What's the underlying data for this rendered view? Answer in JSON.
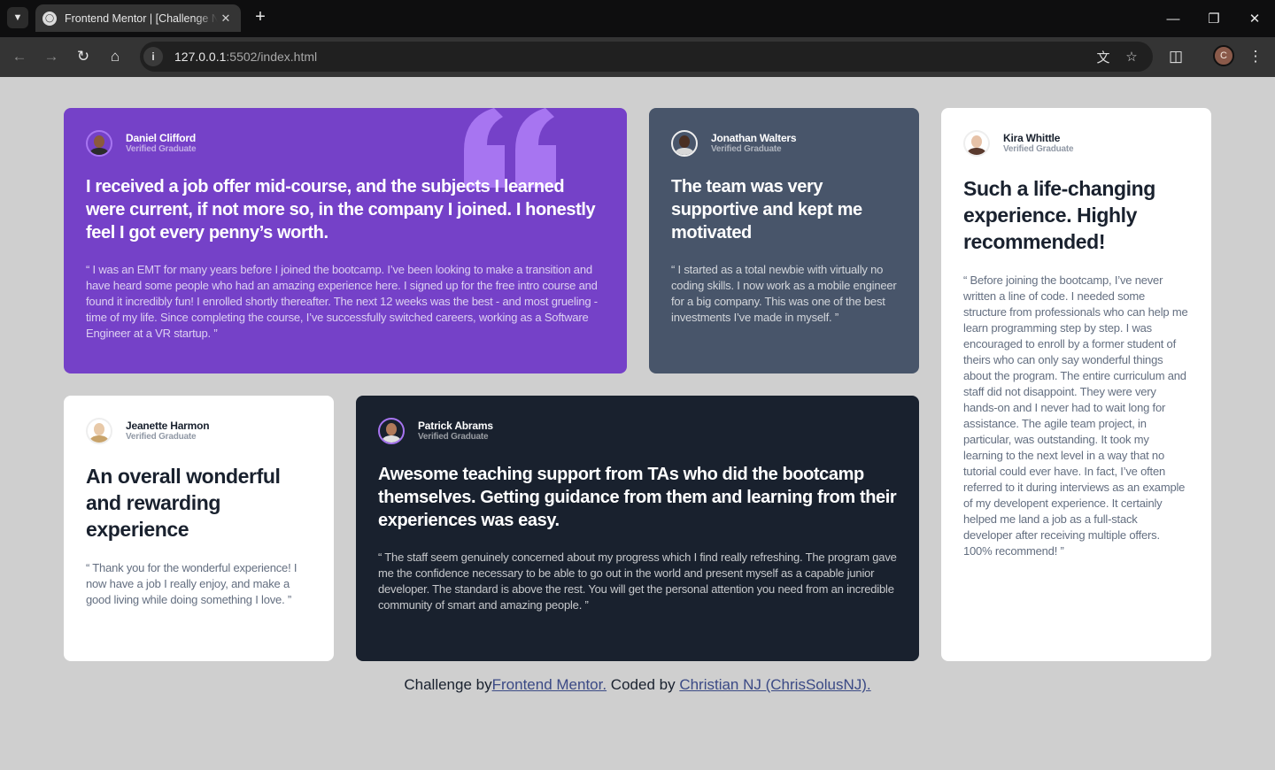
{
  "browser": {
    "tab_title": "Frontend Mentor | [Challenge N",
    "url_host": "127.0.0.1",
    "url_rest": ":5502/index.html",
    "profile_initial": "C"
  },
  "testimonials": [
    {
      "name": "Daniel Clifford",
      "role": "Verified Graduate",
      "headline": "I received a job offer mid-course, and the subjects I learned were current, if not more so, in the company I joined. I honestly feel I got every penny’s worth.",
      "body": "“ I was an EMT for many years before I joined the bootcamp. I’ve been looking to make a transition and have heard some people who had an amazing experience here. I signed up for the free intro course and found it incredibly fun! I enrolled shortly thereafter. The next 12 weeks was the best - and most grueling - time of my life. Since completing the course, I’ve successfully switched careers, working as a Software Engineer at a VR startup. ”"
    },
    {
      "name": "Jonathan Walters",
      "role": "Verified Graduate",
      "headline": "The team was very supportive and kept me motivated",
      "body": "“ I started as a total newbie with virtually no coding skills. I now work as a mobile engineer for a big company. This was one of the best investments I’ve made in myself. ”"
    },
    {
      "name": "Kira Whittle",
      "role": "Verified Graduate",
      "headline": "Such a life-changing experience. Highly recommended!",
      "body": "“ Before joining the bootcamp, I’ve never written a line of code. I needed some structure from professionals who can help me learn programming step by step. I was encouraged to enroll by a former student of theirs who can only say wonderful things about the program. The entire curriculum and staff did not disappoint. They were very hands-on and I never had to wait long for assistance. The agile team project, in particular, was outstanding. It took my learning to the next level in a way that no tutorial could ever have. In fact, I’ve often referred to it during interviews as an example of my developent experience. It certainly helped me land a job as a full-stack developer after receiving multiple offers. 100% recommend! ”"
    },
    {
      "name": "Jeanette Harmon",
      "role": "Verified Graduate",
      "headline": "An overall wonderful and rewarding experience",
      "body": "“ Thank you for the wonderful experience! I now have a job I really enjoy, and make a good living while doing something I love. ”"
    },
    {
      "name": "Patrick Abrams",
      "role": "Verified Graduate",
      "headline": "Awesome teaching support from TAs who did the bootcamp themselves. Getting guidance from them and learning from their experiences was easy.",
      "body": "“ The staff seem genuinely concerned about my progress which I find really refreshing. The program gave me the confidence necessary to be able to go out in the world and present myself as a capable junior developer. The standard is above the rest. You will get the personal attention you need from an incredible community of smart and amazing people. ”"
    }
  ],
  "footer": {
    "prefix": "Challenge by",
    "link1": "Frontend Mentor.",
    "middle": " Coded by ",
    "link2": "Christian NJ (ChrisSolusNJ)."
  },
  "colors": {
    "purple": "#7541c8",
    "slate": "#48556a",
    "dark": "#19212e",
    "page_bg": "#cfcfcf"
  }
}
